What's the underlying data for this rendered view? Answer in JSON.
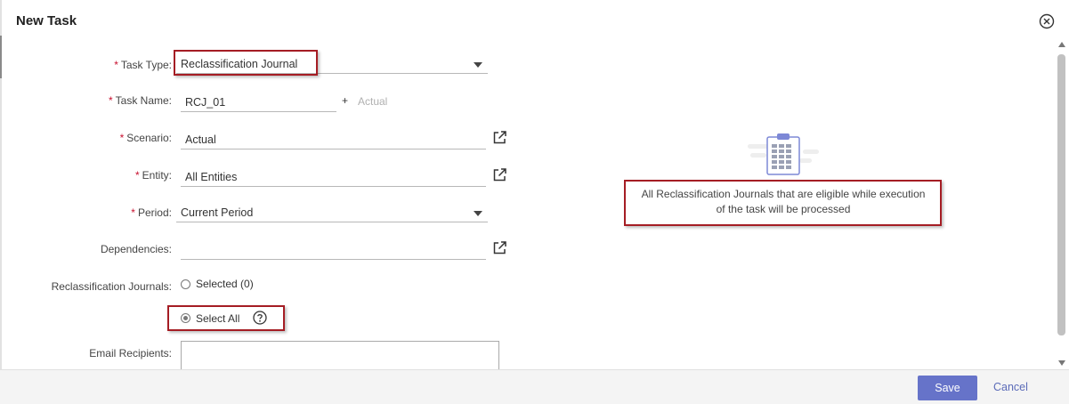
{
  "dialog": {
    "title": "New Task"
  },
  "form": {
    "task_type": {
      "label": "Task Type:",
      "value": "Reclassification Journal"
    },
    "task_name": {
      "label": "Task Name:",
      "value": "RCJ_01",
      "plus": "+",
      "hint": "Actual"
    },
    "scenario": {
      "label": "Scenario:",
      "value": "Actual"
    },
    "entity": {
      "label": "Entity:",
      "value": "All Entities"
    },
    "period": {
      "label": "Period:",
      "value": "Current Period"
    },
    "dependencies": {
      "label": "Dependencies:",
      "value": ""
    },
    "reclassification_journals": {
      "label": "Reclassification Journals:",
      "option_selected": "Selected (0)",
      "option_select_all": "Select All",
      "checked": "Select All"
    },
    "email_recipients": {
      "label": "Email Recipients:",
      "value": ""
    },
    "required_marker": "*"
  },
  "info_panel": {
    "icon": "clipboard-icon",
    "line1": "All Reclassification Journals that are eligible while execution",
    "line2": "of the task will be processed"
  },
  "footer": {
    "save_label": "Save",
    "cancel_label": "Cancel"
  },
  "colors": {
    "accent": "#6673c9",
    "highlight": "#a51d24",
    "required": "#c8102e"
  }
}
